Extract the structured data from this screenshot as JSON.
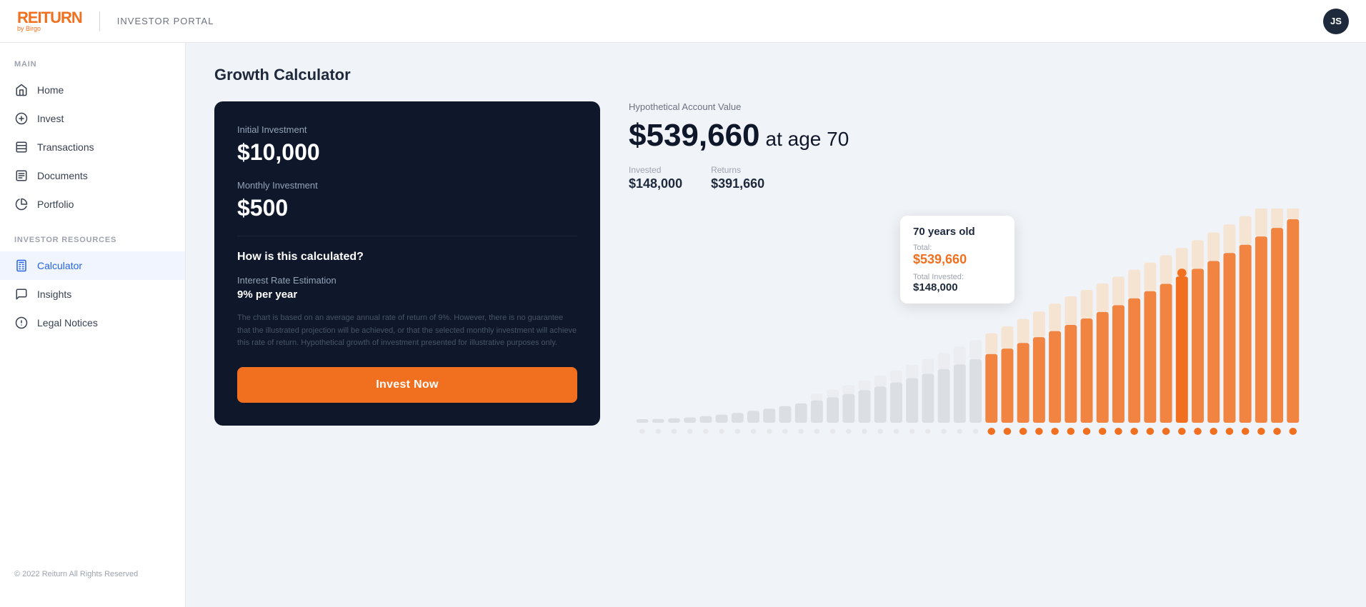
{
  "header": {
    "logo": "REITURN",
    "by_birgo": "by Birgo",
    "portal_label": "INVESTOR PORTAL",
    "avatar_initials": "JS"
  },
  "sidebar": {
    "main_section": "Main",
    "items_main": [
      {
        "label": "Home",
        "icon": "home-icon",
        "active": false
      },
      {
        "label": "Invest",
        "icon": "dollar-icon",
        "active": false
      },
      {
        "label": "Transactions",
        "icon": "transactions-icon",
        "active": false
      },
      {
        "label": "Documents",
        "icon": "documents-icon",
        "active": false
      },
      {
        "label": "Portfolio",
        "icon": "portfolio-icon",
        "active": false
      }
    ],
    "resources_section": "Investor Resources",
    "items_resources": [
      {
        "label": "Calculator",
        "icon": "calculator-icon",
        "active": true
      },
      {
        "label": "Insights",
        "icon": "insights-icon",
        "active": false
      },
      {
        "label": "Legal Notices",
        "icon": "legal-icon",
        "active": false
      }
    ],
    "footer": "© 2022 Reiturn All Rights Reserved"
  },
  "page": {
    "title": "Growth Calculator"
  },
  "calculator": {
    "initial_investment_label": "Initial Investment",
    "initial_investment_value": "$10,000",
    "monthly_investment_label": "Monthly Investment",
    "monthly_investment_value": "$500",
    "how_title": "How is this calculated?",
    "interest_label": "Interest Rate Estimation",
    "interest_value": "9% per year",
    "disclaimer": "The chart is based on an average annual rate of return of 9%. However, there is no guarantee that the illustrated projection will be achieved, or that the selected monthly investment will achieve this rate of return. Hypothetical growth of investment presented for illustrative purposes only.",
    "invest_btn": "Invest Now"
  },
  "results": {
    "hypo_label": "Hypothetical Account Value",
    "value": "$539,660",
    "age_text": "at age 70",
    "invested_label": "Invested",
    "invested_value": "$148,000",
    "returns_label": "Returns",
    "returns_value": "$391,660"
  },
  "tooltip": {
    "age": "70 years old",
    "total_label": "Total:",
    "total_value": "$539,660",
    "invested_label": "Total Invested:",
    "invested_value": "$148,000"
  },
  "colors": {
    "orange": "#f07020",
    "dark_navy": "#0f172a",
    "bar_gray": "#d1d5db",
    "bar_orange": "#f07020"
  }
}
